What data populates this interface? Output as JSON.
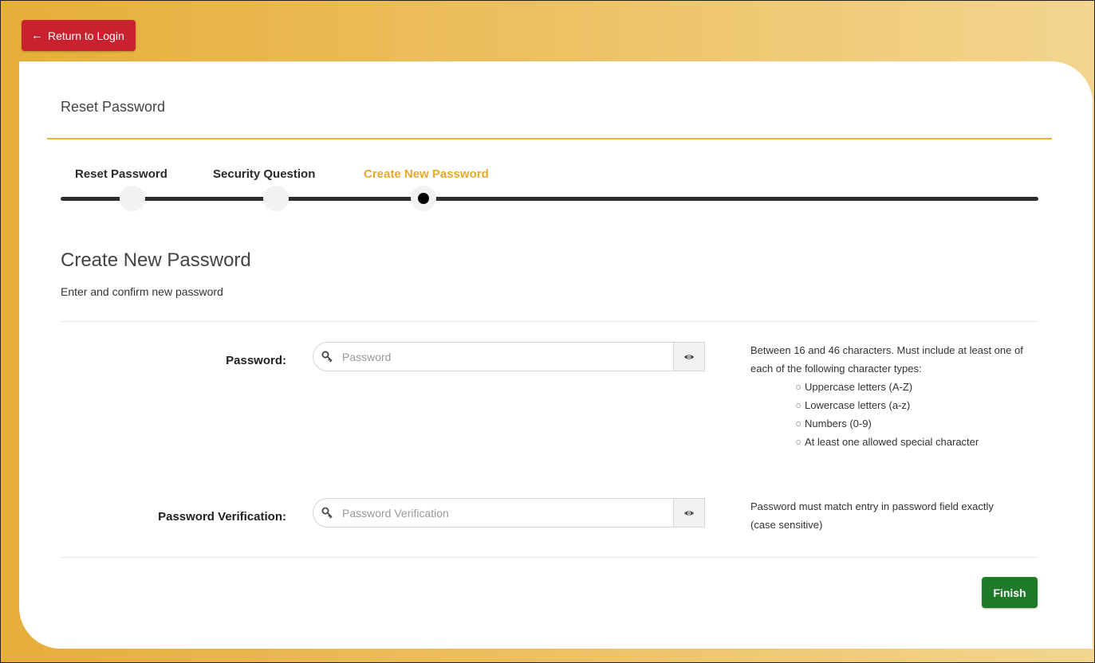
{
  "header": {
    "return_label": "Return to Login",
    "return_icon": "arrow-left-icon",
    "accent_color": "#c8222e"
  },
  "card": {
    "title": "Reset Password",
    "rule_color": "#e8b23b"
  },
  "steps": [
    {
      "label": "Reset Password",
      "state": "complete"
    },
    {
      "label": "Security Question",
      "state": "complete"
    },
    {
      "label": "Create New Password",
      "state": "active"
    }
  ],
  "active_step_color": "#e8a92a",
  "section": {
    "title": "Create New Password",
    "subtitle": "Enter and confirm new password"
  },
  "password_field": {
    "label": "Password:",
    "placeholder": "Password",
    "value": "",
    "help_text": "Between 16 and 46 characters. Must include at least one of each of the following character types:",
    "requirements": [
      "Uppercase letters (A-Z)",
      "Lowercase letters (a-z)",
      "Numbers (0-9)",
      "At least one allowed special character"
    ]
  },
  "verification_field": {
    "label": "Password Verification:",
    "placeholder": "Password Verification",
    "value": "",
    "help_text": "Password must match entry in password field exactly (case sensitive)"
  },
  "finish": {
    "label": "Finish",
    "color": "#1f7a28"
  }
}
